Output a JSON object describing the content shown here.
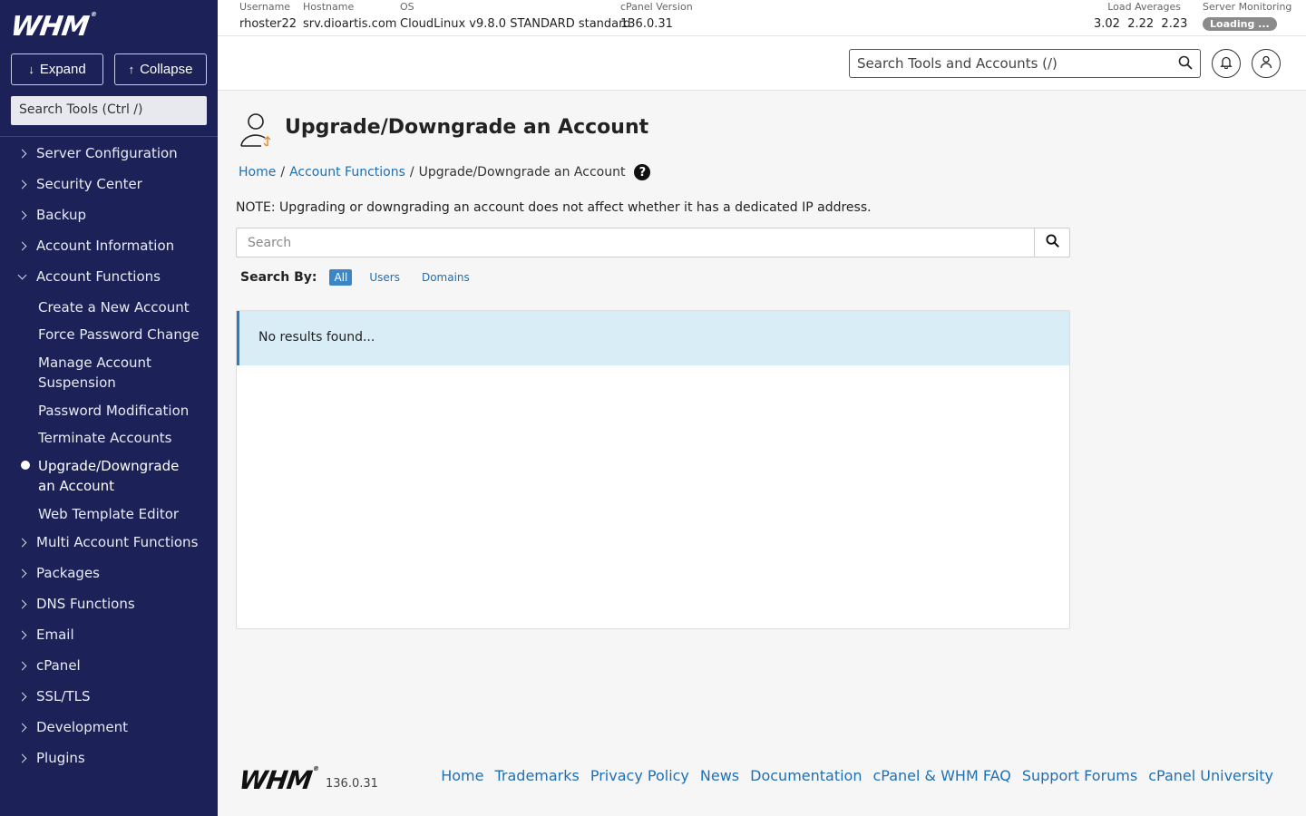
{
  "brand": {
    "logo": "WHM",
    "logo_mark": "®"
  },
  "sidebar": {
    "expand_label": "Expand",
    "collapse_label": "Collapse",
    "search_placeholder": "Search Tools (Ctrl /)",
    "items": [
      {
        "label": "Server Configuration"
      },
      {
        "label": "Security Center"
      },
      {
        "label": "Backup"
      },
      {
        "label": "Account Information"
      },
      {
        "label": "Account Functions"
      },
      {
        "label": "Multi Account Functions"
      },
      {
        "label": "Packages"
      },
      {
        "label": "DNS Functions"
      },
      {
        "label": "Email"
      },
      {
        "label": "cPanel"
      },
      {
        "label": "SSL/TLS"
      },
      {
        "label": "Development"
      },
      {
        "label": "Plugins"
      }
    ],
    "sub_items": [
      {
        "label": "Create a New Account"
      },
      {
        "label": "Force Password Change"
      },
      {
        "label": "Manage Account Suspension"
      },
      {
        "label": "Password Modification"
      },
      {
        "label": "Terminate Accounts"
      },
      {
        "label": "Upgrade/Downgrade an Account"
      },
      {
        "label": "Web Template Editor"
      }
    ]
  },
  "topbar": {
    "username": {
      "label": "Username",
      "value": "rhoster22"
    },
    "hostname": {
      "label": "Hostname",
      "value": "srv.dioartis.com"
    },
    "os": {
      "label": "OS",
      "value": "CloudLinux v9.8.0 STANDARD standard"
    },
    "cpanel_version": {
      "label": "cPanel Version",
      "value": "136.0.31"
    },
    "load_averages": {
      "label": "Load Averages",
      "value": "3.02  2.22  2.23"
    },
    "server_monitoring": {
      "label": "Server Monitoring",
      "value": "Loading ..."
    }
  },
  "header": {
    "search_placeholder": "Search Tools and Accounts (/)"
  },
  "main": {
    "title": "Upgrade/Downgrade an Account",
    "breadcrumb": {
      "home": "Home",
      "section": "Account Functions",
      "current": "Upgrade/Downgrade an Account",
      "sep": "/"
    },
    "note": "NOTE: Upgrading or downgrading an account does not affect whether it has a dedicated IP address.",
    "search_placeholder": "Search",
    "search_by_label": "Search By:",
    "search_by_options": [
      "All",
      "Users",
      "Domains"
    ],
    "no_results": "No results found..."
  },
  "footer": {
    "logo": "WHM",
    "version": "136.0.31",
    "links": [
      "Home",
      "Trademarks",
      "Privacy Policy",
      "News",
      "Documentation",
      "cPanel & WHM FAQ",
      "Support Forums",
      "cPanel University"
    ]
  }
}
